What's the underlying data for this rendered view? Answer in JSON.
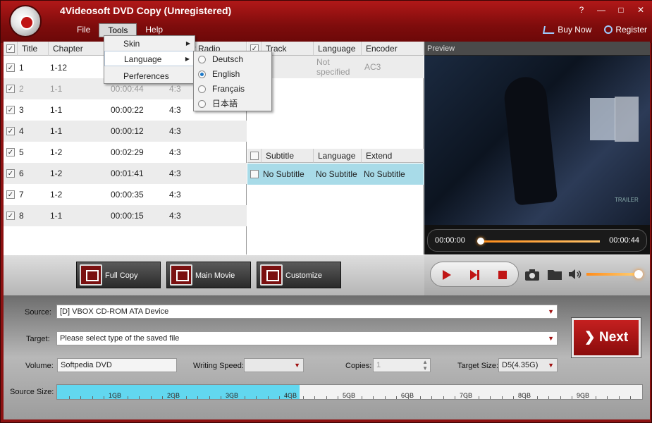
{
  "app": {
    "title": "4Videosoft DVD Copy (Unregistered)"
  },
  "window_controls": {
    "help": "?",
    "minimize": "—",
    "maximize": "□",
    "close": "✕"
  },
  "menubar": {
    "file": "File",
    "tools": "Tools",
    "help": "Help"
  },
  "topright": {
    "buy": "Buy Now",
    "register": "Register"
  },
  "tools_menu": {
    "items": [
      {
        "label": "Skin",
        "submenu_arrow": "▶"
      },
      {
        "label": "Language",
        "submenu_arrow": "▶"
      },
      {
        "label": "Perferences"
      }
    ]
  },
  "language_menu": {
    "items": [
      {
        "label": "Deutsch",
        "selected": false
      },
      {
        "label": "English",
        "selected": true
      },
      {
        "label": "Français",
        "selected": false
      },
      {
        "label": "日本語",
        "selected": false
      }
    ]
  },
  "title_list": {
    "headers": [
      "Title",
      "Chapter",
      "Aspect Radio"
    ],
    "rows": [
      {
        "title": "1",
        "chapter": "1-12",
        "length": "",
        "aspect": ""
      },
      {
        "title": "2",
        "chapter": "1-1",
        "length": "00:00:44",
        "aspect": "4:3"
      },
      {
        "title": "3",
        "chapter": "1-1",
        "length": "00:00:22",
        "aspect": "4:3"
      },
      {
        "title": "4",
        "chapter": "1-1",
        "length": "00:00:12",
        "aspect": "4:3"
      },
      {
        "title": "5",
        "chapter": "1-2",
        "length": "00:02:29",
        "aspect": "4:3"
      },
      {
        "title": "6",
        "chapter": "1-2",
        "length": "00:01:41",
        "aspect": "4:3"
      },
      {
        "title": "7",
        "chapter": "1-2",
        "length": "00:00:35",
        "aspect": "4:3"
      },
      {
        "title": "8",
        "chapter": "1-1",
        "length": "00:00:15",
        "aspect": "4:3"
      }
    ]
  },
  "track_list": {
    "headers": [
      "Track",
      "Language",
      "Encoder"
    ],
    "row": {
      "language_line1": "Not",
      "language_line2": "specified",
      "encoder": "AC3"
    }
  },
  "subtitle_list": {
    "headers": [
      "Subtitle",
      "Language",
      "Extend"
    ],
    "row": {
      "subtitle": "No Subtitle",
      "language": "No Subtitle",
      "extend": "No Subtitle"
    }
  },
  "preview": {
    "label": "Preview",
    "current_time": "00:00:00",
    "total_time": "00:00:44",
    "trailer_mark": "TRAILER"
  },
  "mode_buttons": {
    "full_copy": "Full Copy",
    "main_movie": "Main Movie",
    "customize": "Customize"
  },
  "form": {
    "source_label": "Source:",
    "source_value": "[D] VBOX CD-ROM ATA Device",
    "target_label": "Target:",
    "target_value": "Please select type of the saved file",
    "volume_label": "Volume:",
    "volume_value": "Softpedia DVD",
    "speed_label": "Writing Speed:",
    "speed_value": "",
    "copies_label": "Copies:",
    "copies_value": "1",
    "target_size_label": "Target Size:",
    "target_size_value": "D5(4.35G)",
    "source_size_label": "Source Size:"
  },
  "next_button": {
    "arrow": "❯",
    "label": "Next"
  },
  "source_size": {
    "fill_fraction": 0.415,
    "ticks": [
      "1GB",
      "2GB",
      "3GB",
      "4GB",
      "5GB",
      "6GB",
      "7GB",
      "8GB",
      "9GB"
    ]
  },
  "colors": {
    "accent": "#8c1111",
    "size_fill": "#62d7ef",
    "seek": "#ff8c1a"
  }
}
